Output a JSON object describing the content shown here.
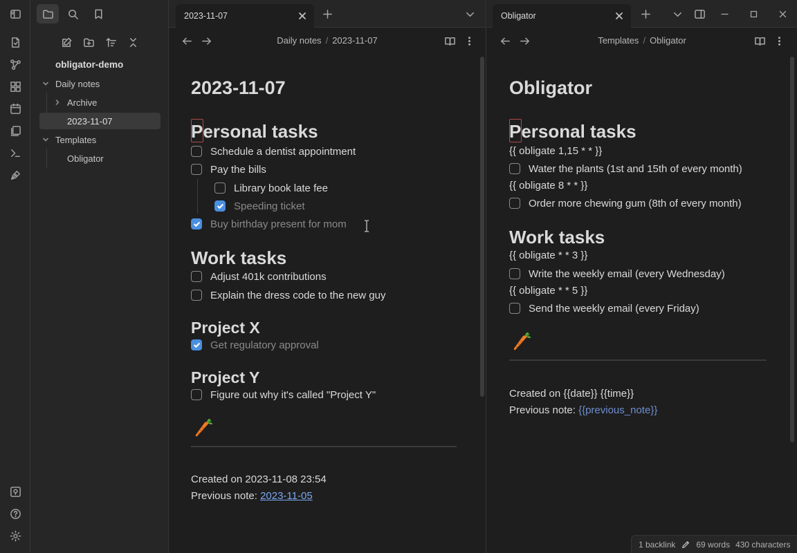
{
  "sidebar": {
    "vault_name": "obligator-demo",
    "tree": [
      {
        "label": "Daily notes",
        "type": "folder",
        "expanded": true
      },
      {
        "label": "Archive",
        "type": "folder",
        "expanded": false
      },
      {
        "label": "2023-11-07",
        "type": "file",
        "active": true
      },
      {
        "label": "Templates",
        "type": "folder",
        "expanded": true
      },
      {
        "label": "Obligator",
        "type": "file"
      }
    ]
  },
  "left_pane": {
    "tab_title": "2023-11-07",
    "breadcrumb": {
      "folder": "Daily notes",
      "file": "2023-11-07"
    },
    "title": "2023-11-07",
    "personal_heading": "Personal tasks",
    "personal_tasks": [
      {
        "text": "Schedule a dentist appointment",
        "done": false
      },
      {
        "text": "Pay the bills",
        "done": false
      },
      {
        "text": "Library book late fee",
        "done": false
      },
      {
        "text": "Speeding ticket",
        "done": true
      },
      {
        "text": "Buy birthday present for mom",
        "done": true
      }
    ],
    "work_heading": "Work tasks",
    "work_tasks": [
      {
        "text": "Adjust 401k contributions",
        "done": false
      },
      {
        "text": "Explain the dress code to the new guy",
        "done": false
      }
    ],
    "projx_heading": "Project X",
    "projx_tasks": [
      {
        "text": "Get regulatory approval",
        "done": true
      }
    ],
    "projy_heading": "Project Y",
    "projy_tasks": [
      {
        "text": "Figure out why it's called \"Project Y\"",
        "done": false
      }
    ],
    "created_line": "Created on 2023-11-08 23:54",
    "previous_label": "Previous note: ",
    "previous_link": "2023-11-05"
  },
  "right_pane": {
    "tab_title": "Obligator",
    "breadcrumb": {
      "folder": "Templates",
      "file": "Obligator"
    },
    "title": "Obligator",
    "personal_heading": "Personal tasks",
    "obligate_1": "{{ obligate 1,15 * * }}",
    "task_1": "Water the plants (1st and 15th of every month)",
    "obligate_2": "{{ obligate 8 * * }}",
    "task_2": "Order more chewing gum (8th of every month)",
    "work_heading": "Work tasks",
    "obligate_3": "{{ obligate * * 3 }}",
    "task_3": "Write the weekly email (every Wednesday)",
    "obligate_4": "{{ obligate * * 5 }}",
    "task_4": "Send the weekly email (every Friday)",
    "created_line": "Created on {{date}} {{time}}",
    "previous_label": "Previous note: ",
    "previous_link": "{{previous_note}}"
  },
  "statusbar": {
    "backlinks": "1 backlink",
    "words": "69 words",
    "characters": "430 characters"
  },
  "colors": {
    "accent": "#4a8fe0",
    "link": "#7aa7f0",
    "background": "#1e1e1e",
    "chrome": "#262626"
  }
}
